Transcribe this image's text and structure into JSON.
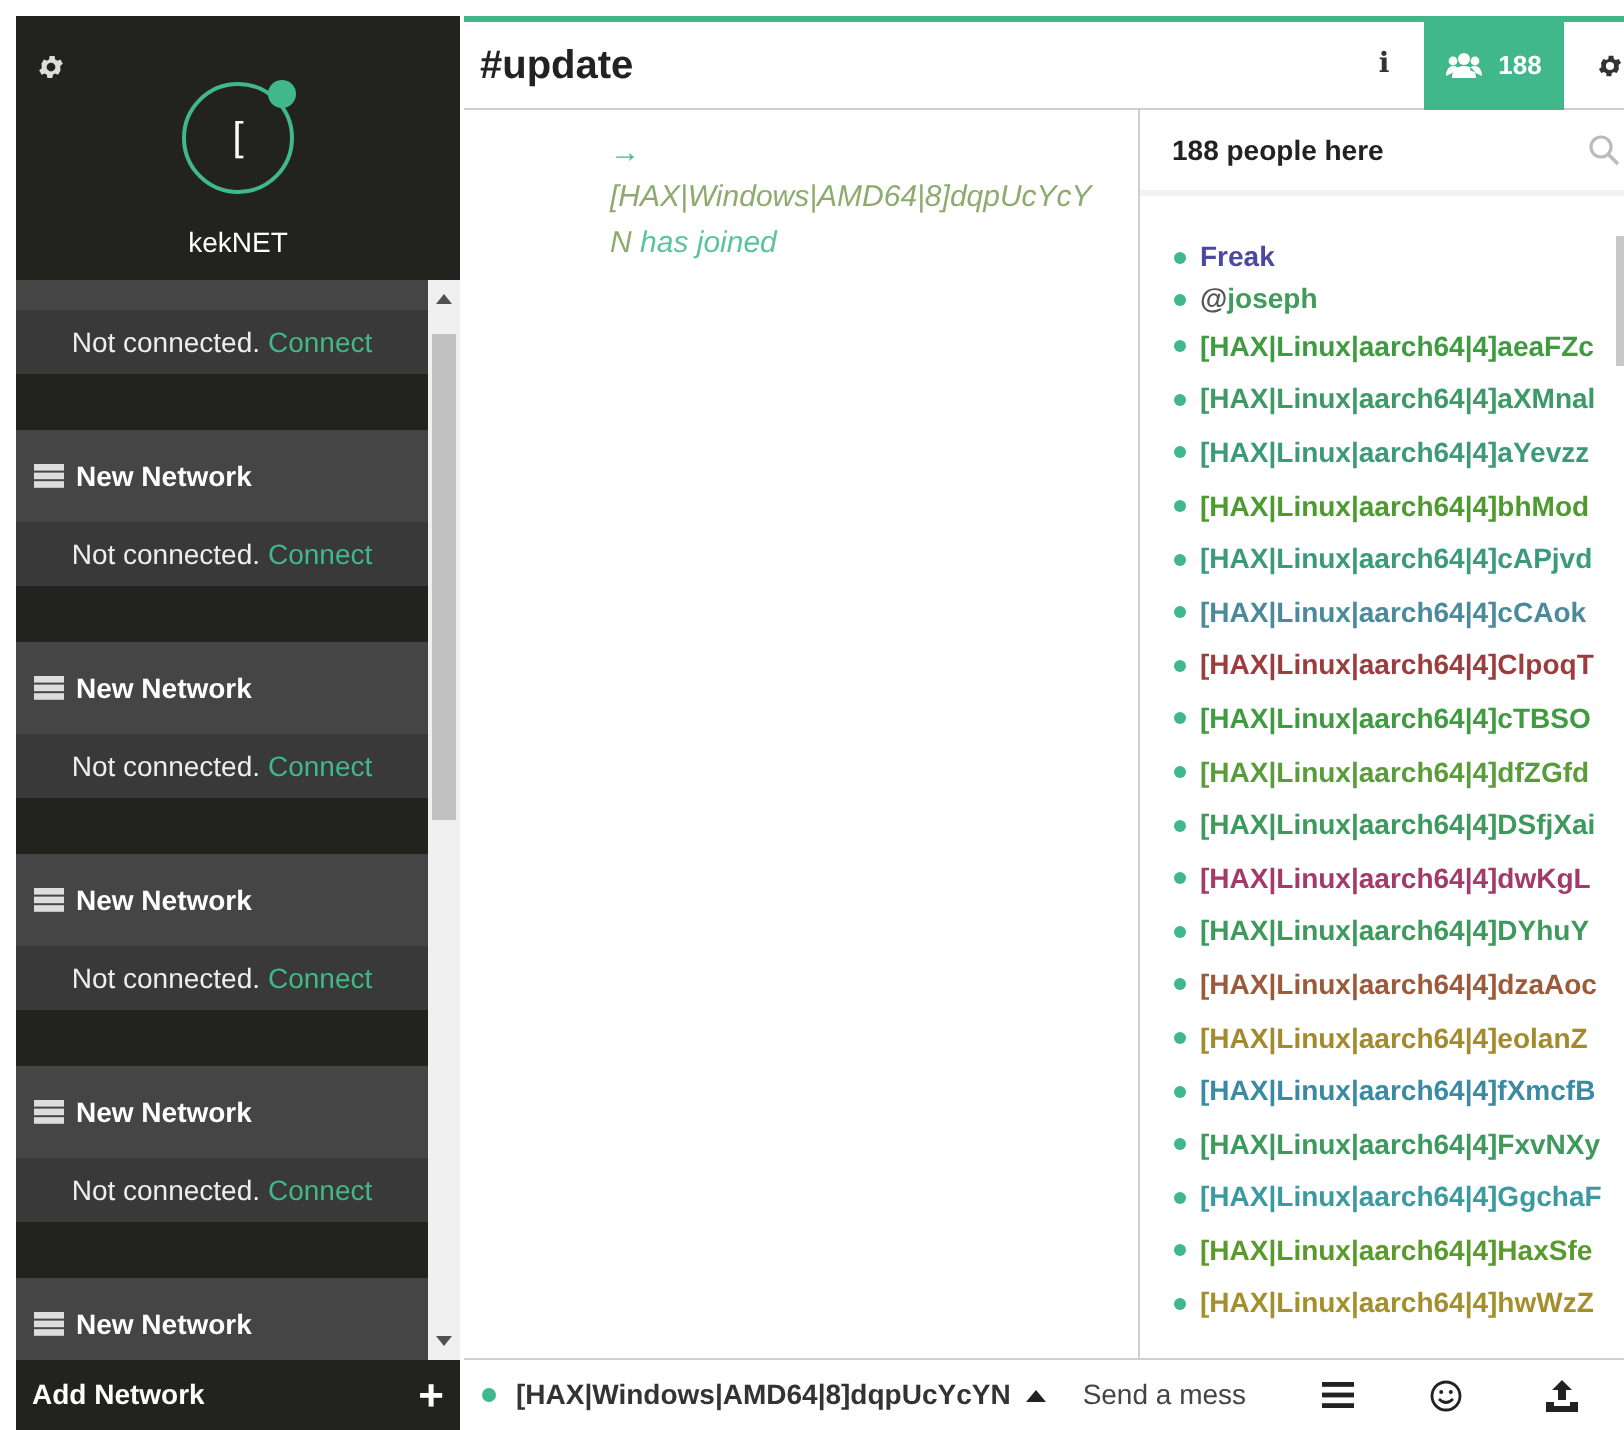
{
  "sidebar": {
    "network_title": "kekNET",
    "avatar_letter": "[",
    "online": true,
    "networks": [
      {
        "status": "Not connected.",
        "action": "Connect"
      },
      {
        "name": "New Network",
        "status": "Not connected.",
        "action": "Connect"
      },
      {
        "name": "New Network",
        "status": "Not connected.",
        "action": "Connect"
      },
      {
        "name": "New Network",
        "status": "Not connected.",
        "action": "Connect"
      },
      {
        "name": "New Network",
        "status": "Not connected.",
        "action": "Connect"
      },
      {
        "name": "New Network"
      }
    ],
    "add_network": "Add Network",
    "add_icon": "+"
  },
  "channel": {
    "title": "#update",
    "info_icon": "i",
    "user_count": "188",
    "members_selected": true
  },
  "messages": [
    {
      "kind": "join",
      "arrow": "→",
      "nick": "[HAX|Windows|AMD64|8]dqpUcYcYN",
      "text": "has joined",
      "color": "#8cab6c"
    }
  ],
  "userlist": {
    "header": "188 people here",
    "users": [
      {
        "name": "Freak",
        "color": "#4a48a0"
      },
      {
        "mode": "@",
        "name": "joseph",
        "color": "#3f9c5c"
      },
      {
        "name": "[HAX|Linux|aarch64|4]aeaFZc",
        "color": "#3f9b3f"
      },
      {
        "name": "[HAX|Linux|aarch64|4]aXMnal",
        "color": "#3d9a66"
      },
      {
        "name": "[HAX|Linux|aarch64|4]aYevzz",
        "color": "#3d9a78"
      },
      {
        "name": "[HAX|Linux|aarch64|4]bhMod",
        "color": "#4d9b2e"
      },
      {
        "name": "[HAX|Linux|aarch64|4]cAPjvd",
        "color": "#3a9a7c"
      },
      {
        "name": "[HAX|Linux|aarch64|4]cCAok",
        "color": "#4a8a9c"
      },
      {
        "name": "[HAX|Linux|aarch64|4]ClpoqT",
        "color": "#9c3d3d"
      },
      {
        "name": "[HAX|Linux|aarch64|4]cTBSO",
        "color": "#3f9b3f"
      },
      {
        "name": "[HAX|Linux|aarch64|4]dfZGfd",
        "color": "#5a9b3a"
      },
      {
        "name": "[HAX|Linux|aarch64|4]DSfjXai",
        "color": "#3d9a5c"
      },
      {
        "name": "[HAX|Linux|aarch64|4]dwKgL",
        "color": "#a33a6a"
      },
      {
        "name": "[HAX|Linux|aarch64|4]DYhuY",
        "color": "#3d9a5c"
      },
      {
        "name": "[HAX|Linux|aarch64|4]dzaAoc",
        "color": "#9c5a3a"
      },
      {
        "name": "[HAX|Linux|aarch64|4]eolanZ",
        "color": "#a38a2c"
      },
      {
        "name": "[HAX|Linux|aarch64|4]fXmcfB",
        "color": "#3a8aa3"
      },
      {
        "name": "[HAX|Linux|aarch64|4]FxvNXy",
        "color": "#3d9a5c"
      },
      {
        "name": "[HAX|Linux|aarch64|4]GgchaF",
        "color": "#3a9aa0"
      },
      {
        "name": "[HAX|Linux|aarch64|4]HaxSfe",
        "color": "#5a9a2c"
      },
      {
        "name": "[HAX|Linux|aarch64|4]hwWzZ",
        "color": "#a3902c"
      }
    ]
  },
  "composer": {
    "nick": "[HAX|Windows|AMD64|8]dqpUcYcYN",
    "placeholder": "Send a mess"
  }
}
